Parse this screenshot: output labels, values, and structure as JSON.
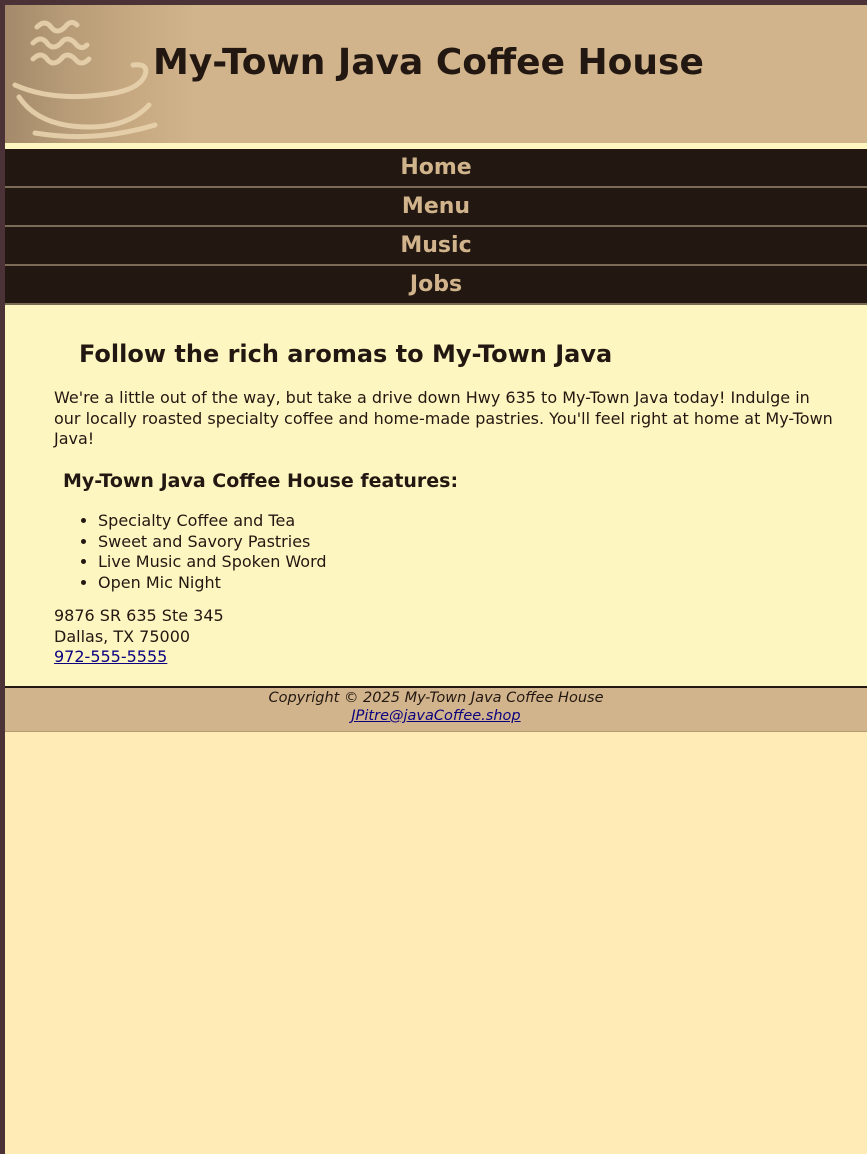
{
  "header": {
    "title": "My-Town Java Coffee House"
  },
  "nav": {
    "items": [
      {
        "label": "Home"
      },
      {
        "label": "Menu"
      },
      {
        "label": "Music"
      },
      {
        "label": "Jobs"
      }
    ]
  },
  "main": {
    "heading": "Follow the rich aromas to My-Town Java",
    "intro": "We're a little out of the way, but take a drive down Hwy 635 to My-Town Java today! Indulge in our locally roasted specialty coffee and home-made pastries. You'll feel right at home at My-Town Java!",
    "features_heading": "My-Town Java Coffee House features:",
    "features": [
      "Specialty Coffee and Tea",
      "Sweet and Savory Pastries",
      "Live Music and Spoken Word",
      "Open Mic Night"
    ],
    "address": {
      "street": "9876 SR 635 Ste 345",
      "city": "Dallas, TX 75000",
      "phone": "972-555-5555"
    }
  },
  "footer": {
    "copyright": "Copyright © 2025 My-Town Java Coffee House",
    "email": "JPitre@javaCoffee.shop"
  },
  "colors": {
    "header_bg": "#d2b48c",
    "nav_bg": "#221811",
    "nav_text": "#d2b48c",
    "main_bg": "#fef6c1",
    "page_bg": "#feebb6",
    "text": "#221811",
    "link": "#0b0080"
  }
}
